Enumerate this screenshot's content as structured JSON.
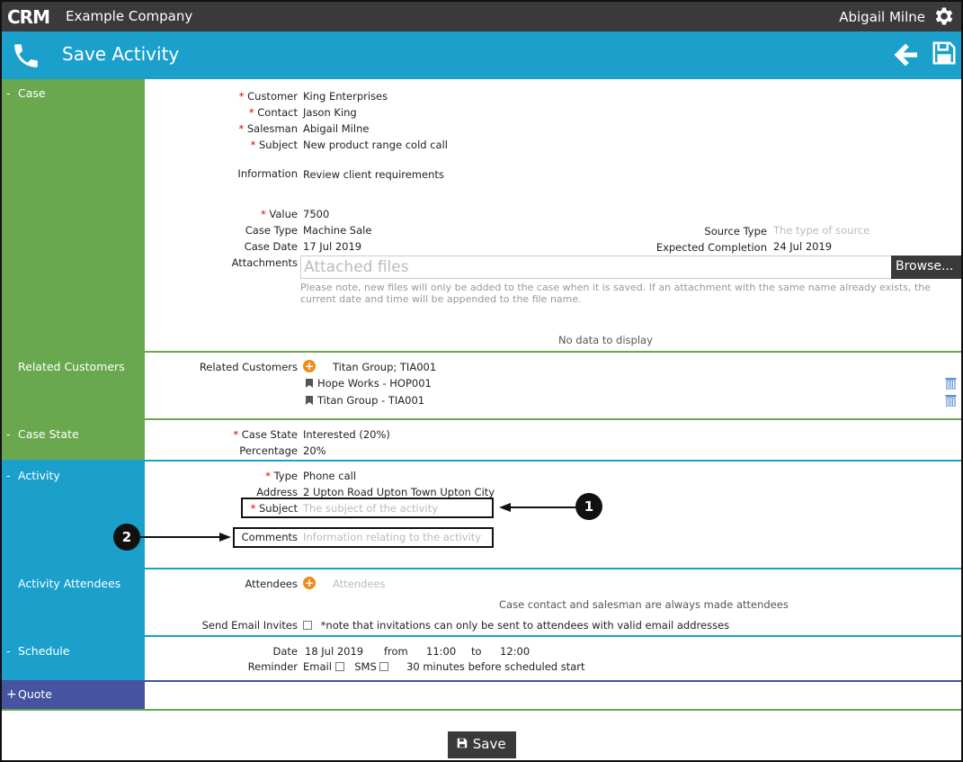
{
  "topbar": {
    "logo": "CRM",
    "company": "Example Company",
    "user": "Abigail Milne"
  },
  "header": {
    "title": "Save Activity"
  },
  "sections": {
    "case": "Case",
    "related_customers": "Related Customers",
    "case_state": "Case State",
    "activity": "Activity",
    "activity_attendees": "Activity Attendees",
    "schedule": "Schedule",
    "quote": "Quote"
  },
  "case": {
    "customer_label": "Customer",
    "customer": "King Enterprises",
    "contact_label": "Contact",
    "contact": "Jason King",
    "salesman_label": "Salesman",
    "salesman": "Abigail Milne",
    "subject_label": "Subject",
    "subject": "New product range cold call",
    "information_label": "Information",
    "information": "Review client requirements",
    "value_label": "Value",
    "value": "7500",
    "case_type_label": "Case Type",
    "case_type": "Machine Sale",
    "case_date_label": "Case Date",
    "case_date": "17 Jul 2019",
    "source_type_label": "Source Type",
    "source_type_placeholder": "The type of source",
    "expected_completion_label": "Expected Completion",
    "expected_completion": "24 Jul 2019",
    "attachments_label": "Attachments",
    "attachments_placeholder": "Attached files",
    "browse_label": "Browse...",
    "attachments_note": "Please note, new files will only be added to the case when it is saved. If an attachment with the same name already exists, the current date and time will be appended to the file name.",
    "no_data": "No data to display"
  },
  "related": {
    "label": "Related Customers",
    "input_value": "Titan Group; TIA001",
    "items": [
      "Hope Works - HOP001",
      "Titan Group - TIA001"
    ]
  },
  "case_state": {
    "state_label": "Case State",
    "state": "Interested (20%)",
    "percentage_label": "Percentage",
    "percentage": "20%"
  },
  "activity": {
    "type_label": "Type",
    "type": "Phone call",
    "address_label": "Address",
    "address": "2 Upton Road Upton Town Upton City",
    "subject_label": "Subject",
    "subject_placeholder": "The subject of the activity",
    "comments_label": "Comments",
    "comments_placeholder": "Information relating to the activity"
  },
  "attendees": {
    "label": "Attendees",
    "placeholder": "Attendees",
    "note": "Case contact and salesman are always made attendees",
    "send_email_label": "Send Email Invites",
    "send_email_note": "*note that invitations can only be sent to attendees with valid email addresses"
  },
  "schedule": {
    "date_label": "Date",
    "date": "18 Jul 2019",
    "from_label": "from",
    "from": "11:00",
    "to_label": "to",
    "to": "12:00",
    "reminder_label": "Reminder",
    "email_label": "Email",
    "sms_label": "SMS",
    "minutes": "30 minutes",
    "before": "before scheduled start"
  },
  "callouts": {
    "one": "1",
    "two": "2"
  },
  "footer": {
    "save_label": "Save"
  },
  "colors": {
    "green": "#6aa84f",
    "blue": "#1ba0cc",
    "purple": "#4553a0",
    "dark": "#3a3a3a",
    "orange": "#f08c1a"
  }
}
